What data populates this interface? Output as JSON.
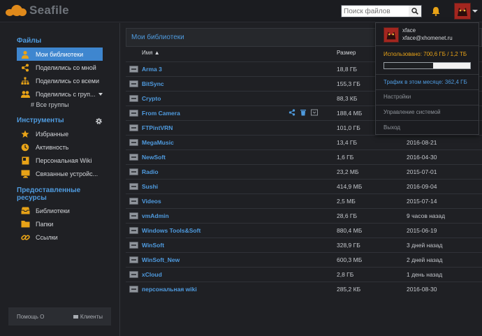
{
  "header": {
    "brand": "Seafile",
    "search_placeholder": "Поиск файлов"
  },
  "sidebar": {
    "files_title": "Файлы",
    "files_items": [
      {
        "label": "Мои библиотеки",
        "icon": "user-icon"
      },
      {
        "label": "Поделились со мной",
        "icon": "share-icon"
      },
      {
        "label": "Поделились со всеми",
        "icon": "org-icon"
      },
      {
        "label": "Поделились с груп...",
        "icon": "group-icon"
      }
    ],
    "all_groups": "# Все группы",
    "tools_title": "Инструменты",
    "tools_items": [
      {
        "label": "Избранные",
        "icon": "star-icon"
      },
      {
        "label": "Активность",
        "icon": "clock-icon"
      },
      {
        "label": "Персональная Wiki",
        "icon": "wiki-icon"
      },
      {
        "label": "Связанные устройс...",
        "icon": "monitor-icon"
      }
    ],
    "shared_title_line1": "Предоставленные",
    "shared_title_line2": "ресурсы",
    "shared_items": [
      {
        "label": "Библиотеки",
        "icon": "inbox-icon"
      },
      {
        "label": "Папки",
        "icon": "folder-icon"
      },
      {
        "label": "Ссылки",
        "icon": "link-icon"
      }
    ],
    "footer_help": "Помощь",
    "footer_clients": "Клиенты"
  },
  "main": {
    "title": "Мои библиотеки",
    "col_name": "Имя ▲",
    "col_size": "Размер",
    "libraries": [
      {
        "name": "Arma 3",
        "size": "18,8 ГБ",
        "date": ""
      },
      {
        "name": "BitSync",
        "size": "155,3 ГБ",
        "date": ""
      },
      {
        "name": "Crypto",
        "size": "88,3 КБ",
        "date": ""
      },
      {
        "name": "From Camera",
        "size": "188,4 МБ",
        "date": ""
      },
      {
        "name": "FTPintVRN",
        "size": "101,0 ГБ",
        "date": ""
      },
      {
        "name": "MegaMusic",
        "size": "13,4 ГБ",
        "date": "2016-08-21"
      },
      {
        "name": "NewSoft",
        "size": "1,6 ГБ",
        "date": "2016-04-30"
      },
      {
        "name": "Radio",
        "size": "23,2 МБ",
        "date": "2015-07-01"
      },
      {
        "name": "Sushi",
        "size": "414,9 МБ",
        "date": "2016-09-04"
      },
      {
        "name": "Videos",
        "size": "2,5 МБ",
        "date": "2015-07-14"
      },
      {
        "name": "vmAdmin",
        "size": "28,6 ГБ",
        "date": "9 часов назад"
      },
      {
        "name": "Windows Tools&Soft",
        "size": "880,4 МБ",
        "date": "2015-06-19"
      },
      {
        "name": "WinSoft",
        "size": "328,9 ГБ",
        "date": "3 дней назад"
      },
      {
        "name": "WinSoft_New",
        "size": "600,3 МБ",
        "date": "2 дней назад"
      },
      {
        "name": "xCloud",
        "size": "2,8 ГБ",
        "date": "1 день назад"
      },
      {
        "name": "персональная wiki",
        "size": "285,2 КБ",
        "date": "2016-08-30"
      }
    ]
  },
  "user_menu": {
    "name": "xface",
    "email": "xface@xhomenet.ru",
    "quota_text": "Использовано: 700,6 ГБ / 1,2 ТБ",
    "quota_fraction": 0.57,
    "traffic_text": "Трафик в этом месяце: 362,4 ГБ",
    "settings": "Настройки",
    "admin": "Управление системой",
    "logout": "Выход"
  },
  "colors": {
    "accent": "#3e86cf",
    "link": "#4f9bdf",
    "brand_orange": "#e08a1b",
    "quota_text": "#e8a317"
  }
}
